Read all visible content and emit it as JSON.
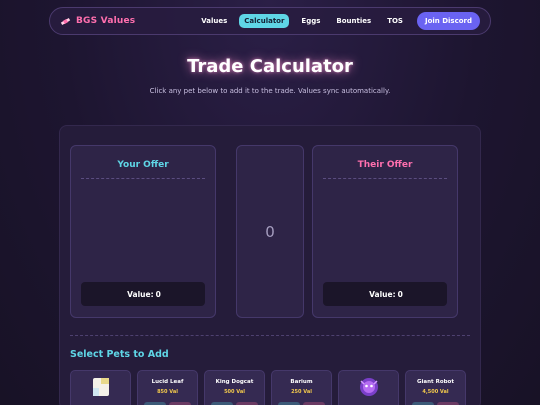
{
  "nav": {
    "brand": "BGS Values",
    "links": [
      "Values",
      "Calculator",
      "Eggs",
      "Bounties",
      "TOS"
    ],
    "active": "Calculator",
    "discord": "Join Discord"
  },
  "hero": {
    "title": "Trade Calculator",
    "subtitle": "Click any pet below to add it to the trade. Values sync automatically."
  },
  "your_offer": {
    "title": "Your Offer",
    "value_label": "Value:",
    "value": "0"
  },
  "their_offer": {
    "title": "Their Offer",
    "value_label": "Value:",
    "value": "0"
  },
  "difference": "0",
  "pets_section": {
    "title": "Select Pets to Add",
    "pets": [
      {
        "name": "",
        "value": "",
        "icon": "pet-image-white-icon"
      },
      {
        "name": "Lucid Leaf",
        "value": "850 Val"
      },
      {
        "name": "King Dogcat",
        "value": "500 Val"
      },
      {
        "name": "Barium",
        "value": "250 Val"
      },
      {
        "name": "",
        "value": "",
        "icon": "purple-pet-icon"
      },
      {
        "name": "Giant Robot",
        "value": "4,500 Val"
      }
    ]
  },
  "colors": {
    "accent_cyan": "#5fd6e6",
    "accent_pink": "#ff6fae",
    "discord": "#6a63f2",
    "value_gold": "#f2c94c"
  }
}
